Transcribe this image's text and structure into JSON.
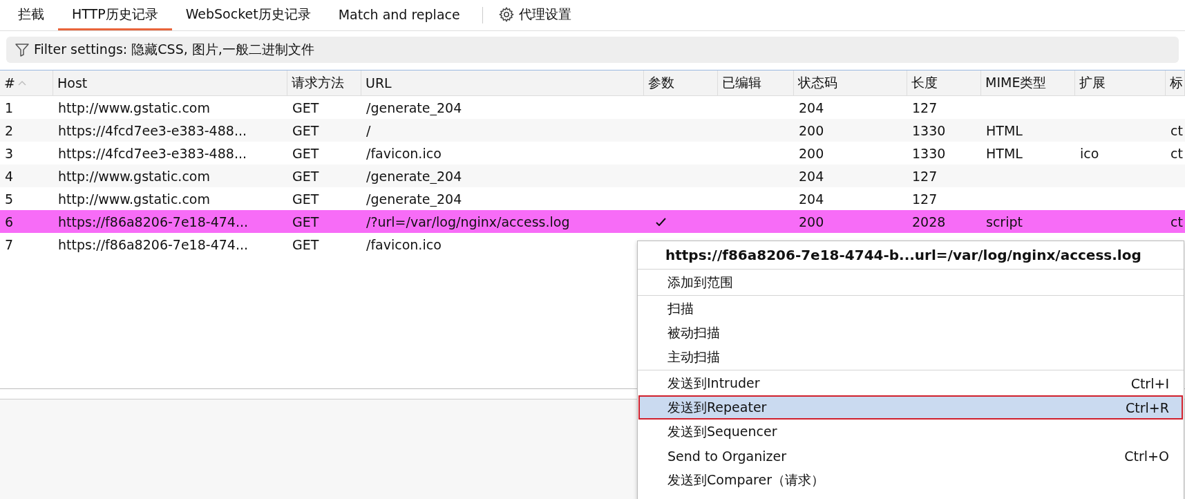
{
  "tabs": [
    {
      "label": "拦截",
      "selected": false
    },
    {
      "label": "HTTP历史记录",
      "selected": true
    },
    {
      "label": "WebSocket历史记录",
      "selected": false
    },
    {
      "label": "Match and replace",
      "selected": false
    }
  ],
  "settings_tab": {
    "label": "代理设置"
  },
  "filter": {
    "label": "Filter settings: 隐藏CSS, 图片,一般二进制文件"
  },
  "table": {
    "columns": [
      "#",
      "Host",
      "请求方法",
      "URL",
      "参数",
      "已编辑",
      "状态码",
      "长度",
      "MIME类型",
      "扩展",
      "标"
    ],
    "rows": [
      {
        "cells": [
          "1",
          "http://www.gstatic.com",
          "GET",
          "/generate_204",
          "",
          "",
          "204",
          "127",
          "",
          "",
          ""
        ],
        "params": false
      },
      {
        "cells": [
          "2",
          "https://4fcd7ee3-e383-488...",
          "GET",
          "/",
          "",
          "",
          "200",
          "1330",
          "HTML",
          "",
          "ct"
        ],
        "params": false
      },
      {
        "cells": [
          "3",
          "https://4fcd7ee3-e383-488...",
          "GET",
          "/favicon.ico",
          "",
          "",
          "200",
          "1330",
          "HTML",
          "ico",
          "ct"
        ],
        "params": false
      },
      {
        "cells": [
          "4",
          "http://www.gstatic.com",
          "GET",
          "/generate_204",
          "",
          "",
          "204",
          "127",
          "",
          "",
          ""
        ],
        "params": false
      },
      {
        "cells": [
          "5",
          "http://www.gstatic.com",
          "GET",
          "/generate_204",
          "",
          "",
          "204",
          "127",
          "",
          "",
          ""
        ],
        "params": false
      },
      {
        "cells": [
          "6",
          "https://f86a8206-7e18-474...",
          "GET",
          "/?url=/var/log/nginx/access.log",
          "",
          "",
          "200",
          "2028",
          "script",
          "",
          "ct"
        ],
        "params": true,
        "color": "#f76cf7"
      },
      {
        "cells": [
          "7",
          "https://f86a8206-7e18-474...",
          "GET",
          "/favicon.ico",
          "",
          "",
          "",
          "",
          "",
          "",
          ""
        ],
        "params": false
      }
    ]
  },
  "context_menu": {
    "title": "https://f86a8206-7e18-4744-b...url=/var/log/nginx/access.log",
    "sections": [
      [
        {
          "label": "添加到范围",
          "selected": false
        }
      ],
      [
        {
          "label": "扫描",
          "selected": false
        },
        {
          "label": "被动扫描",
          "selected": false
        },
        {
          "label": "主动扫描",
          "selected": false
        }
      ],
      [
        {
          "label": "发送到Intruder",
          "shortcut": "Ctrl+I",
          "selected": false
        },
        {
          "label": "发送到Repeater",
          "shortcut": "Ctrl+R",
          "selected": true
        },
        {
          "label": "发送到Sequencer",
          "selected": false
        },
        {
          "label": "Send to Organizer",
          "shortcut": "Ctrl+O",
          "selected": false
        },
        {
          "label": "发送到Comparer（请求）",
          "selected": false
        }
      ]
    ]
  }
}
